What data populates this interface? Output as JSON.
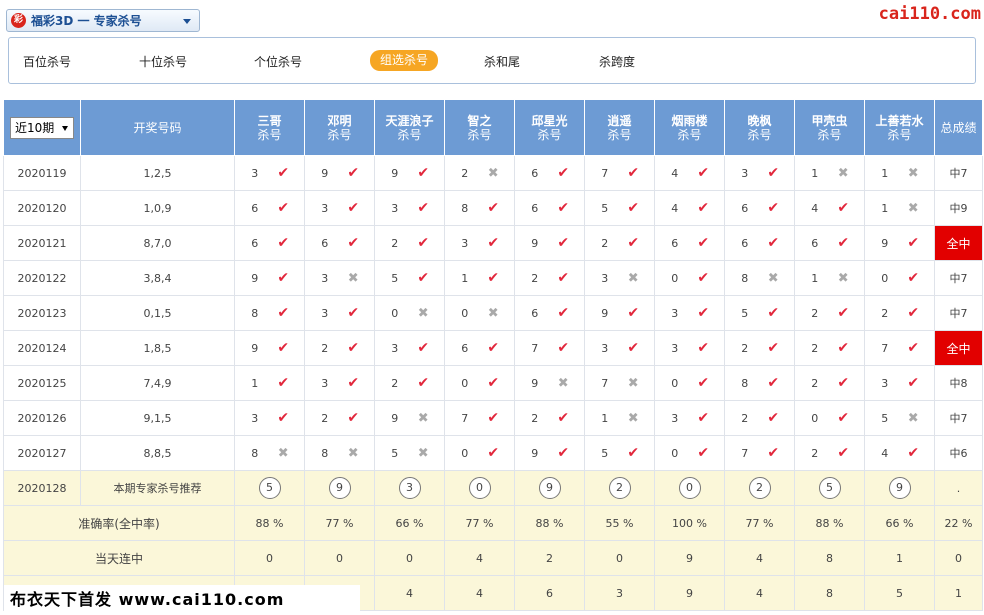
{
  "header": {
    "lottery_select": "福彩3D 一 专家杀号",
    "logo_mark": "彩",
    "site": "cai110.com"
  },
  "tabs": [
    {
      "label": "百位杀号",
      "active": false
    },
    {
      "label": "十位杀号",
      "active": false
    },
    {
      "label": "个位杀号",
      "active": false
    },
    {
      "label": "组选杀号",
      "active": true
    },
    {
      "label": "杀和尾",
      "active": false
    },
    {
      "label": "杀跨度",
      "active": false
    }
  ],
  "table": {
    "period_select": "近10期",
    "col_draw": "开奖号码",
    "col_total": "总成绩",
    "experts": [
      {
        "name": "三哥",
        "sub": "杀号"
      },
      {
        "name": "邓明",
        "sub": "杀号"
      },
      {
        "name": "天涯浪子",
        "sub": "杀号"
      },
      {
        "name": "智之",
        "sub": "杀号"
      },
      {
        "name": "邱星光",
        "sub": "杀号"
      },
      {
        "name": "逍遥",
        "sub": "杀号"
      },
      {
        "name": "烟雨楼",
        "sub": "杀号"
      },
      {
        "name": "晚枫",
        "sub": "杀号"
      },
      {
        "name": "甲壳虫",
        "sub": "杀号"
      },
      {
        "name": "上善若水",
        "sub": "杀号"
      }
    ],
    "rows": [
      {
        "issue": "2020119",
        "draw": "1,2,5",
        "kills": [
          [
            3,
            true
          ],
          [
            9,
            true
          ],
          [
            9,
            true
          ],
          [
            2,
            false
          ],
          [
            6,
            true
          ],
          [
            7,
            true
          ],
          [
            4,
            true
          ],
          [
            3,
            true
          ],
          [
            1,
            false
          ],
          [
            1,
            false
          ]
        ],
        "total": "中7",
        "all_hit": false
      },
      {
        "issue": "2020120",
        "draw": "1,0,9",
        "kills": [
          [
            6,
            true
          ],
          [
            3,
            true
          ],
          [
            3,
            true
          ],
          [
            8,
            true
          ],
          [
            6,
            true
          ],
          [
            5,
            true
          ],
          [
            4,
            true
          ],
          [
            6,
            true
          ],
          [
            4,
            true
          ],
          [
            1,
            false
          ]
        ],
        "total": "中9",
        "all_hit": false
      },
      {
        "issue": "2020121",
        "draw": "8,7,0",
        "kills": [
          [
            6,
            true
          ],
          [
            6,
            true
          ],
          [
            2,
            true
          ],
          [
            3,
            true
          ],
          [
            9,
            true
          ],
          [
            2,
            true
          ],
          [
            6,
            true
          ],
          [
            6,
            true
          ],
          [
            6,
            true
          ],
          [
            9,
            true
          ]
        ],
        "total": "全中",
        "all_hit": true
      },
      {
        "issue": "2020122",
        "draw": "3,8,4",
        "kills": [
          [
            9,
            true
          ],
          [
            3,
            false
          ],
          [
            5,
            true
          ],
          [
            1,
            true
          ],
          [
            2,
            true
          ],
          [
            3,
            false
          ],
          [
            0,
            true
          ],
          [
            8,
            false
          ],
          [
            1,
            false
          ],
          [
            0,
            true
          ]
        ],
        "total": "中7",
        "all_hit": false
      },
      {
        "issue": "2020123",
        "draw": "0,1,5",
        "kills": [
          [
            8,
            true
          ],
          [
            3,
            true
          ],
          [
            0,
            false
          ],
          [
            0,
            false
          ],
          [
            6,
            true
          ],
          [
            9,
            true
          ],
          [
            3,
            true
          ],
          [
            5,
            true
          ],
          [
            2,
            true
          ],
          [
            2,
            true
          ]
        ],
        "total": "中7",
        "all_hit": false
      },
      {
        "issue": "2020124",
        "draw": "1,8,5",
        "kills": [
          [
            9,
            true
          ],
          [
            2,
            true
          ],
          [
            3,
            true
          ],
          [
            6,
            true
          ],
          [
            7,
            true
          ],
          [
            3,
            true
          ],
          [
            3,
            true
          ],
          [
            2,
            true
          ],
          [
            2,
            true
          ],
          [
            7,
            true
          ]
        ],
        "total": "全中",
        "all_hit": true
      },
      {
        "issue": "2020125",
        "draw": "7,4,9",
        "kills": [
          [
            1,
            true
          ],
          [
            3,
            true
          ],
          [
            2,
            true
          ],
          [
            0,
            true
          ],
          [
            9,
            false
          ],
          [
            7,
            false
          ],
          [
            0,
            true
          ],
          [
            8,
            true
          ],
          [
            2,
            true
          ],
          [
            3,
            true
          ]
        ],
        "total": "中8",
        "all_hit": false
      },
      {
        "issue": "2020126",
        "draw": "9,1,5",
        "kills": [
          [
            3,
            true
          ],
          [
            2,
            true
          ],
          [
            9,
            false
          ],
          [
            7,
            true
          ],
          [
            2,
            true
          ],
          [
            1,
            false
          ],
          [
            3,
            true
          ],
          [
            2,
            true
          ],
          [
            0,
            true
          ],
          [
            5,
            false
          ]
        ],
        "total": "中7",
        "all_hit": false
      },
      {
        "issue": "2020127",
        "draw": "8,8,5",
        "kills": [
          [
            8,
            false
          ],
          [
            8,
            false
          ],
          [
            5,
            false
          ],
          [
            0,
            true
          ],
          [
            9,
            true
          ],
          [
            5,
            true
          ],
          [
            0,
            true
          ],
          [
            7,
            true
          ],
          [
            2,
            true
          ],
          [
            4,
            true
          ]
        ],
        "total": "中6",
        "all_hit": false
      }
    ],
    "recommend": {
      "issue": "2020128",
      "label": "本期专家杀号推荐",
      "nums": [
        5,
        9,
        3,
        0,
        9,
        2,
        0,
        2,
        5,
        9
      ],
      "total": "."
    },
    "accuracy": {
      "label": "准确率(全中率)",
      "values": [
        "88 %",
        "77 %",
        "66 %",
        "77 %",
        "88 %",
        "55 %",
        "100 %",
        "77 %",
        "88 %",
        "66 %"
      ],
      "total": "22 %"
    },
    "streak": {
      "label": "当天连中",
      "values": [
        "0",
        "0",
        "0",
        "4",
        "2",
        "0",
        "9",
        "4",
        "8",
        "1"
      ],
      "total": "0"
    },
    "max_streak": {
      "label": "",
      "values": [
        "",
        "",
        "4",
        "4",
        "6",
        "3",
        "9",
        "4",
        "8",
        "5"
      ],
      "total": "1"
    }
  },
  "watermark": "布衣天下首发 www.cai110.com"
}
